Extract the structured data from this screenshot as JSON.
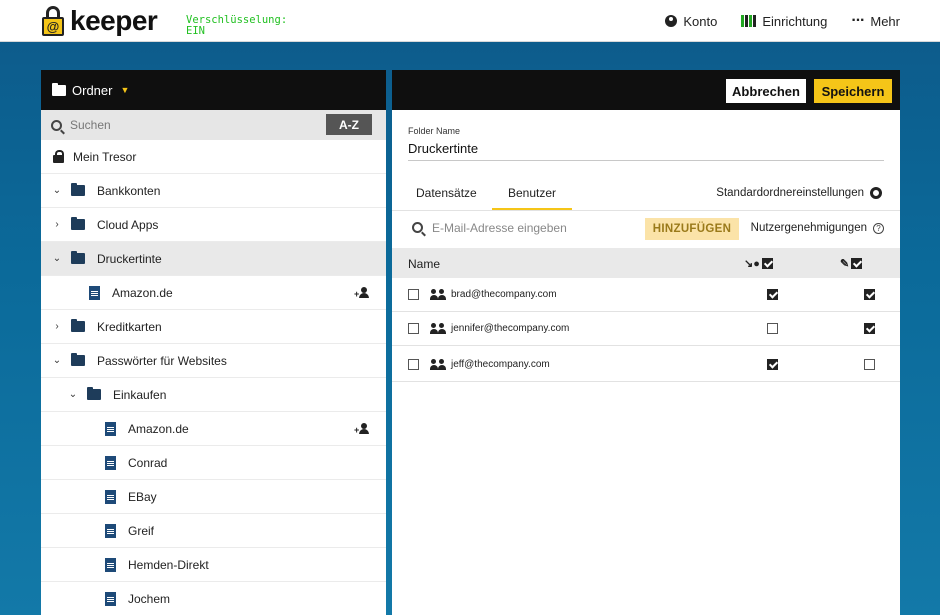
{
  "brand": {
    "name": "keeper",
    "encryption_line1": "Verschlüsselung:",
    "encryption_line2": "EIN"
  },
  "topnav": {
    "account": "Konto",
    "setup": "Einrichtung",
    "more": "Mehr"
  },
  "left_panel": {
    "header": "Ordner",
    "search_placeholder": "Suchen",
    "sort_label": "A-Z",
    "tree": [
      {
        "label": "Mein Tresor",
        "type": "vault"
      },
      {
        "label": "Bankkonten",
        "type": "folder",
        "expanded": true
      },
      {
        "label": "Cloud Apps",
        "type": "folder",
        "expanded": false
      },
      {
        "label": "Druckertinte",
        "type": "shared-folder",
        "expanded": true,
        "selected": true
      },
      {
        "label": "Amazon.de",
        "type": "record",
        "shared": true
      },
      {
        "label": "Kreditkarten",
        "type": "folder",
        "expanded": false
      },
      {
        "label": "Passwörter für Websites",
        "type": "folder",
        "expanded": true
      },
      {
        "label": "Einkaufen",
        "type": "folder",
        "expanded": true
      },
      {
        "label": "Amazon.de",
        "type": "record",
        "shared": true
      },
      {
        "label": "Conrad",
        "type": "record"
      },
      {
        "label": "EBay",
        "type": "record"
      },
      {
        "label": "Greif",
        "type": "record"
      },
      {
        "label": "Hemden-Direkt",
        "type": "record"
      },
      {
        "label": "Jochem",
        "type": "record"
      }
    ]
  },
  "right_panel": {
    "cancel": "Abbrechen",
    "save": "Speichern",
    "folder_name_label": "Folder Name",
    "folder_name_value": "Druckertinte",
    "tabs": {
      "records": "Datensätze",
      "users": "Benutzer"
    },
    "default_settings": "Standardordnereinstellungen",
    "email_placeholder": "E-Mail-Adresse eingeben",
    "add_button": "HINZUFÜGEN",
    "permissions": "Nutzergenehmigungen",
    "table_header_name": "Name",
    "users": [
      {
        "email": "brad@thecompany.com",
        "manage_users": true,
        "manage_records": true
      },
      {
        "email": "jennifer@thecompany.com",
        "manage_users": false,
        "manage_records": true
      },
      {
        "email": "jeff@thecompany.com",
        "manage_users": true,
        "manage_records": false
      }
    ]
  },
  "colors": {
    "accent": "#f5c518",
    "background_blue": "#0d5c8c",
    "encryption_green": "#22c022"
  }
}
